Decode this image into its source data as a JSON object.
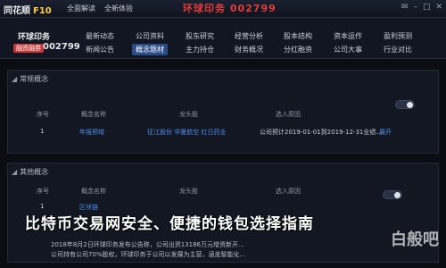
{
  "topbar": {
    "brand_main": "同花顺",
    "brand_sub": "F10",
    "menu": [
      "全面解读",
      "全新体验"
    ],
    "window_title": "环球印务 002799",
    "controls": [
      "✉",
      "–",
      "□",
      "✕"
    ]
  },
  "stock": {
    "name": "环球印务",
    "tag": "融资融券",
    "code": "002799"
  },
  "nav": {
    "row1": [
      "最新动态",
      "公司资料",
      "股东研究",
      "经营分析",
      "股本结构",
      "资本运作",
      "盈利预测"
    ],
    "row2": [
      "新闻公告",
      "概念题材",
      "主力持仓",
      "财务概况",
      "分红融资",
      "公司大事",
      "行业对比"
    ],
    "active": "概念题材"
  },
  "panel_a": {
    "title": "常规概念",
    "headers": [
      "序号",
      "概念名称",
      "龙头股",
      "",
      "选入原因"
    ],
    "row": {
      "index": "1",
      "name": "年报预增",
      "leaders": "征江股份  华夏航空  红日药业",
      "reason": "公司预计2019-01-01到2019-12-31业绩...",
      "expand": "展开"
    }
  },
  "panel_b": {
    "title": "其他概念",
    "headers": [
      "序号",
      "概念名称",
      "龙头股",
      "",
      "选入原因"
    ],
    "row": {
      "index": "1",
      "name": "区块链"
    },
    "news": [
      "2018年8月2日环球印务发布公告称，公司出资13186万元增资新开...",
      "公司持有公司70%股权，环球印务于公司以发展为主营，涵盖智能化..."
    ]
  },
  "overlay": {
    "title": "比特币交易网安全、便捷的钱包选择指南",
    "watermark": "白般吧"
  },
  "colors": {
    "background": "#0b0d12",
    "panel": "#121722",
    "accent_blue": "#4e8ff0",
    "title_red": "#e23b3b",
    "active_tab": "#2a4c86"
  }
}
